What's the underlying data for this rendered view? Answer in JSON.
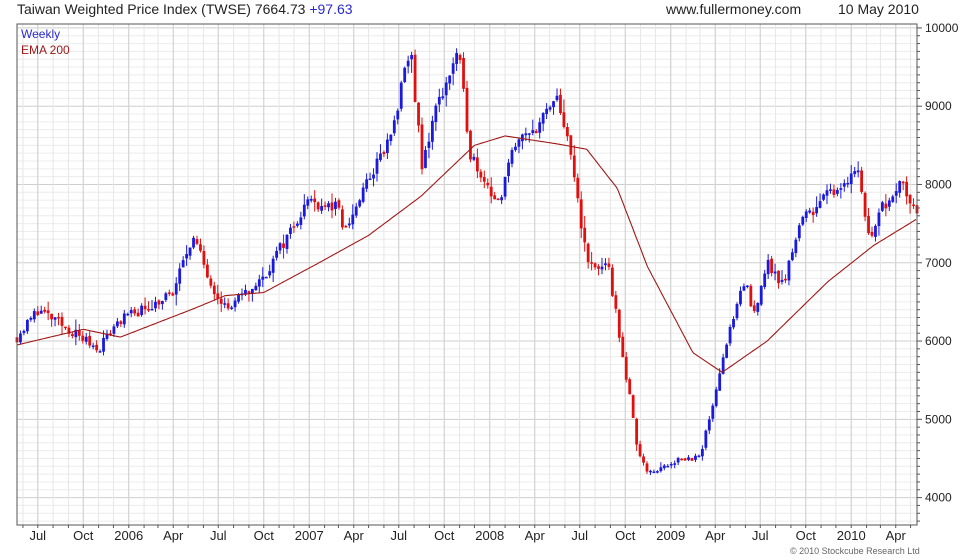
{
  "header": {
    "title": "Taiwan Weighted Price Index (TWSE)",
    "last": "7664.73",
    "change": "+97.63",
    "site": "www.fullermoney.com",
    "date": "10 May 2010"
  },
  "credit": "© 2010 Stockcube Research Ltd",
  "colors": {
    "up": "#1a1adc",
    "down": "#e01010",
    "ema": "#a01818",
    "grid": "#d8d8d8",
    "frame": "#555555"
  },
  "chart_data": {
    "type": "candlestick",
    "legend": [
      "Weekly",
      "EMA 200"
    ],
    "y_ticks": [
      "4000",
      "5000",
      "6000",
      "7000",
      "8000",
      "9000",
      "10000"
    ],
    "x_ticks": [
      "Jul",
      "Oct",
      "2006",
      "Apr",
      "Jul",
      "Oct",
      "2007",
      "Apr",
      "Jul",
      "Oct",
      "2008",
      "Apr",
      "Jul",
      "Oct",
      "2009",
      "Apr",
      "Jul",
      "Oct",
      "2010",
      "Apr"
    ],
    "x_tick_dates": [
      "2005-07-01",
      "2005-10-01",
      "2006-01-01",
      "2006-04-01",
      "2006-07-01",
      "2006-10-01",
      "2007-01-01",
      "2007-04-01",
      "2007-07-01",
      "2007-10-01",
      "2008-01-01",
      "2008-04-01",
      "2008-07-01",
      "2008-10-01",
      "2009-01-01",
      "2009-04-01",
      "2009-07-01",
      "2009-10-01",
      "2010-01-01",
      "2010-04-01"
    ],
    "x_range": [
      "2005-05-20",
      "2010-05-14"
    ],
    "ylim": [
      3650,
      10050
    ],
    "grid": true,
    "anchors_date": [
      "2005-05-20",
      "2005-07-01",
      "2005-09-01",
      "2005-10-31",
      "2005-12-09",
      "2006-03-31",
      "2006-05-09",
      "2006-06-20",
      "2006-07-20",
      "2006-09-29",
      "2006-12-29",
      "2007-02-26",
      "2007-03-14",
      "2007-04-30",
      "2007-06-15",
      "2007-07-25",
      "2007-08-17",
      "2007-09-10",
      "2007-10-29",
      "2007-11-23",
      "2008-01-22",
      "2008-02-15",
      "2008-03-17",
      "2008-05-19",
      "2008-06-20",
      "2008-07-16",
      "2008-08-29",
      "2008-09-29",
      "2008-10-27",
      "2008-11-20",
      "2009-01-14",
      "2009-03-02",
      "2009-04-20",
      "2009-06-02",
      "2009-06-16",
      "2009-07-14",
      "2009-08-17",
      "2009-09-17",
      "2009-11-02",
      "2010-01-15",
      "2010-02-06",
      "2010-02-22",
      "2010-04-15",
      "2010-05-04",
      "2010-05-14"
    ],
    "anchors_close": [
      6050,
      6400,
      6150,
      5900,
      6250,
      6600,
      7350,
      6700,
      6400,
      6800,
      7800,
      7700,
      7400,
      8050,
      8600,
      9750,
      8200,
      8900,
      9700,
      8400,
      7700,
      8500,
      8600,
      9100,
      8100,
      7000,
      6900,
      5700,
      4600,
      4300,
      4500,
      4500,
      5900,
      6800,
      6300,
      7000,
      6700,
      7500,
      7800,
      8200,
      7300,
      7600,
      8100,
      7700,
      7640
    ],
    "ema_date": [
      "2005-05-20",
      "2005-10-01",
      "2005-12-15",
      "2006-05-15",
      "2006-07-15",
      "2006-10-01",
      "2007-01-15",
      "2007-05-01",
      "2007-08-15",
      "2007-12-01",
      "2008-02-01",
      "2008-05-15",
      "2008-07-15",
      "2008-09-15",
      "2008-11-15",
      "2009-02-15",
      "2009-04-15",
      "2009-07-15",
      "2009-11-15",
      "2010-02-15",
      "2010-05-14"
    ],
    "ema_value": [
      5950,
      6150,
      6050,
      6420,
      6580,
      6620,
      6980,
      7350,
      7850,
      8500,
      8620,
      8520,
      8450,
      7950,
      6950,
      5850,
      5600,
      6000,
      6760,
      7220,
      7560
    ]
  }
}
